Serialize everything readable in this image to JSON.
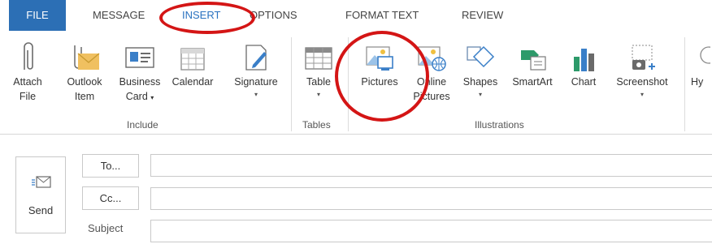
{
  "tabs": {
    "file": "FILE",
    "message": "MESSAGE",
    "insert": "INSERT",
    "options": "OPTIONS",
    "format_text": "FORMAT TEXT",
    "review": "REVIEW"
  },
  "ribbon": {
    "attach_file": [
      "Attach",
      "File"
    ],
    "outlook_item": [
      "Outlook",
      "Item"
    ],
    "business_card": [
      "Business",
      "Card"
    ],
    "calendar": "Calendar",
    "signature": "Signature",
    "table": "Table",
    "pictures": "Pictures",
    "online_pictures": [
      "Online",
      "Pictures"
    ],
    "shapes": "Shapes",
    "smartart": "SmartArt",
    "chart": "Chart",
    "screenshot": "Screenshot",
    "hyperlink_partial": "Hy",
    "groups": {
      "include": "Include",
      "tables": "Tables",
      "illustrations": "Illustrations"
    }
  },
  "compose": {
    "send": "Send",
    "to": "To...",
    "cc": "Cc...",
    "subject": "Subject",
    "to_value": "",
    "cc_value": "",
    "subject_value": ""
  },
  "colors": {
    "accent": "#2c6fb5",
    "highlight": "#d41515"
  }
}
